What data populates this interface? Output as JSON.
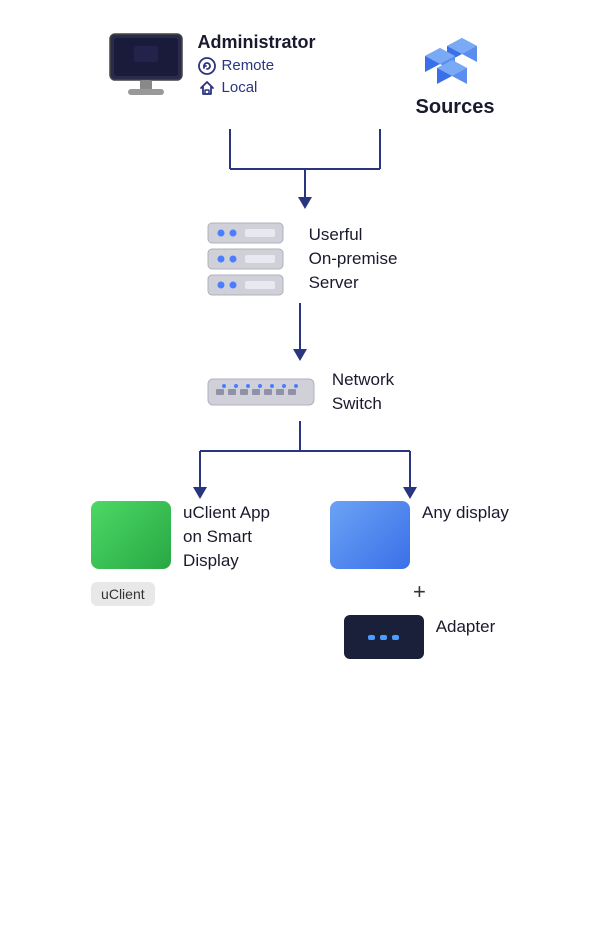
{
  "admin": {
    "title": "Administrator",
    "remote_label": "Remote",
    "local_label": "Local"
  },
  "sources": {
    "title": "Sources"
  },
  "server": {
    "label_line1": "Userful",
    "label_line2": "On-premise",
    "label_line3": "Server"
  },
  "switch": {
    "label_line1": "Network",
    "label_line2": "Switch"
  },
  "uclient": {
    "label_line1": "uClient App",
    "label_line2": "on Smart",
    "label_line3": "Display",
    "badge": "uClient"
  },
  "display": {
    "label": "Any display"
  },
  "adapter": {
    "label": "Adapter"
  },
  "plus": {
    "symbol": "+"
  },
  "colors": {
    "arrow": "#2a3580",
    "green": "#4cd964",
    "blue": "#3a6fe8",
    "dark": "#1a1f3a"
  }
}
